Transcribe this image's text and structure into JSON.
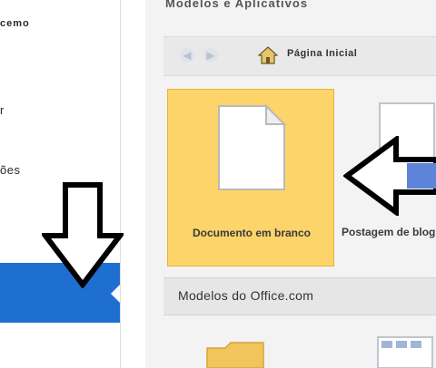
{
  "sidebar": {
    "top_label": "cemo",
    "mid_label": "r",
    "low_label": "ões"
  },
  "main": {
    "section_title": "Modelos e Aplicativos",
    "nav": {
      "home_label": "Página Inicial"
    },
    "templates": [
      {
        "label": "Documento em branco"
      },
      {
        "label": "Postagem de blog"
      }
    ],
    "office_section": "Modelos do Office.com"
  },
  "colors": {
    "accent": "#1f6fd1",
    "selected_tile": "#fcd46a"
  }
}
